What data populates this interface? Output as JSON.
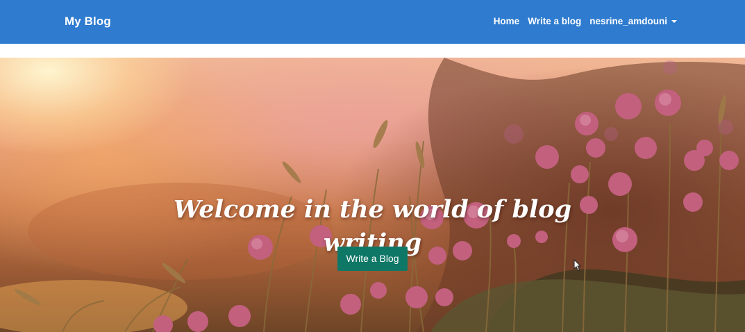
{
  "navbar": {
    "brand": "My Blog",
    "links": {
      "home": "Home",
      "write": "Write a blog",
      "user": "nesrine_amdouni"
    },
    "background_color": "#2e7bcf"
  },
  "hero": {
    "title_line1": "Welcome in the world of blog",
    "title_line2": "writing",
    "button_label": "Write a Blog",
    "button_color": "#0f7766",
    "background": "sunset meadow photo with pink flowers"
  },
  "icons": {
    "user_dropdown": "caret-down-icon",
    "pointer": "mouse-cursor-icon"
  }
}
